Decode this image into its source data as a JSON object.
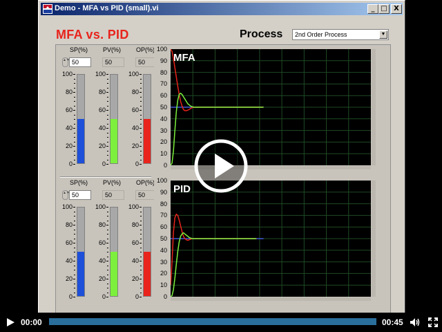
{
  "window": {
    "title": "Demo - MFA vs PID (small).vi",
    "minimize": "_",
    "maximize": "□",
    "close": "X"
  },
  "app": {
    "title": "MFA vs. PID",
    "process_label": "Process",
    "process_selected": "2nd Order Process"
  },
  "sections": [
    {
      "id": "mfa",
      "graph_name": "MFA",
      "sp_label": "SP(%)",
      "pv_label": "PV(%)",
      "op_label": "OP(%)",
      "sp_value": "50",
      "pv_value": "50",
      "op_value": "50",
      "sp_level": 50,
      "pv_level": 50,
      "op_level": 50
    },
    {
      "id": "pid",
      "graph_name": "PID",
      "sp_label": "SP(%)",
      "pv_label": "PV(%)",
      "op_label": "OP(%)",
      "sp_value": "50",
      "pv_value": "50",
      "op_value": "50",
      "sp_level": 50,
      "pv_level": 50,
      "op_level": 50
    }
  ],
  "scale_ticks": [
    "100",
    "80",
    "60",
    "40",
    "20",
    "0"
  ],
  "graph_ticks": [
    "100",
    "90",
    "80",
    "70",
    "60",
    "50",
    "40",
    "30",
    "20",
    "10",
    "0"
  ],
  "colors": {
    "sp": "#1e4fd8",
    "pv": "#7cf03c",
    "op": "#e8241c",
    "setpoint_line": "#4d6cff",
    "grid": "#1f4a24"
  },
  "traces": {
    "mfa": {
      "x": [
        0,
        1,
        2,
        3,
        4,
        5,
        6,
        7,
        8,
        9,
        10,
        11,
        12,
        13,
        14,
        15,
        16,
        17,
        18,
        19,
        20,
        22,
        24,
        26,
        28,
        30,
        32,
        34,
        36,
        38,
        40,
        45,
        50,
        55,
        60,
        65
      ],
      "op": [
        100,
        98,
        92,
        84,
        76,
        68,
        61,
        55,
        51,
        48,
        47,
        47,
        47.5,
        48,
        49,
        49.5,
        50,
        50,
        50,
        50,
        50,
        50,
        50,
        50,
        50,
        50,
        50,
        50,
        50,
        50,
        50,
        50,
        50,
        50,
        50,
        50
      ],
      "pv": [
        0,
        2,
        12,
        30,
        46,
        56,
        61,
        62,
        61,
        59,
        57,
        55,
        53,
        52,
        51,
        50.5,
        50,
        50,
        50,
        50,
        50,
        50,
        50,
        50,
        50,
        50,
        50,
        50,
        50,
        50,
        50,
        50,
        50,
        50,
        50,
        50
      ],
      "sp": 50,
      "sp_end": 65
    },
    "pid": {
      "x": [
        0,
        1,
        2,
        3,
        4,
        5,
        6,
        7,
        8,
        9,
        10,
        11,
        12,
        13,
        14,
        15,
        16,
        17,
        18,
        20,
        22,
        24,
        26,
        28,
        30,
        32,
        34,
        36,
        38,
        40,
        45,
        50,
        55,
        60
      ],
      "op": [
        10,
        30,
        55,
        68,
        71,
        70,
        66,
        61,
        56,
        52,
        50,
        49,
        48.5,
        49,
        49.5,
        50,
        50,
        50,
        50,
        50,
        50,
        50,
        50,
        50,
        50,
        50,
        50,
        50,
        50,
        50,
        50,
        50,
        50,
        50
      ],
      "pv": [
        0,
        1,
        6,
        16,
        28,
        39,
        47,
        52,
        54,
        55,
        54,
        53,
        52,
        51,
        50.5,
        50,
        50,
        50,
        50,
        50,
        50,
        50,
        50,
        50,
        50,
        50,
        50,
        50,
        50,
        50,
        50,
        50,
        50,
        50
      ],
      "sp": 50,
      "sp_end": 65
    }
  },
  "player": {
    "current_time": "00:00",
    "duration": "00:45",
    "progress": 0
  }
}
